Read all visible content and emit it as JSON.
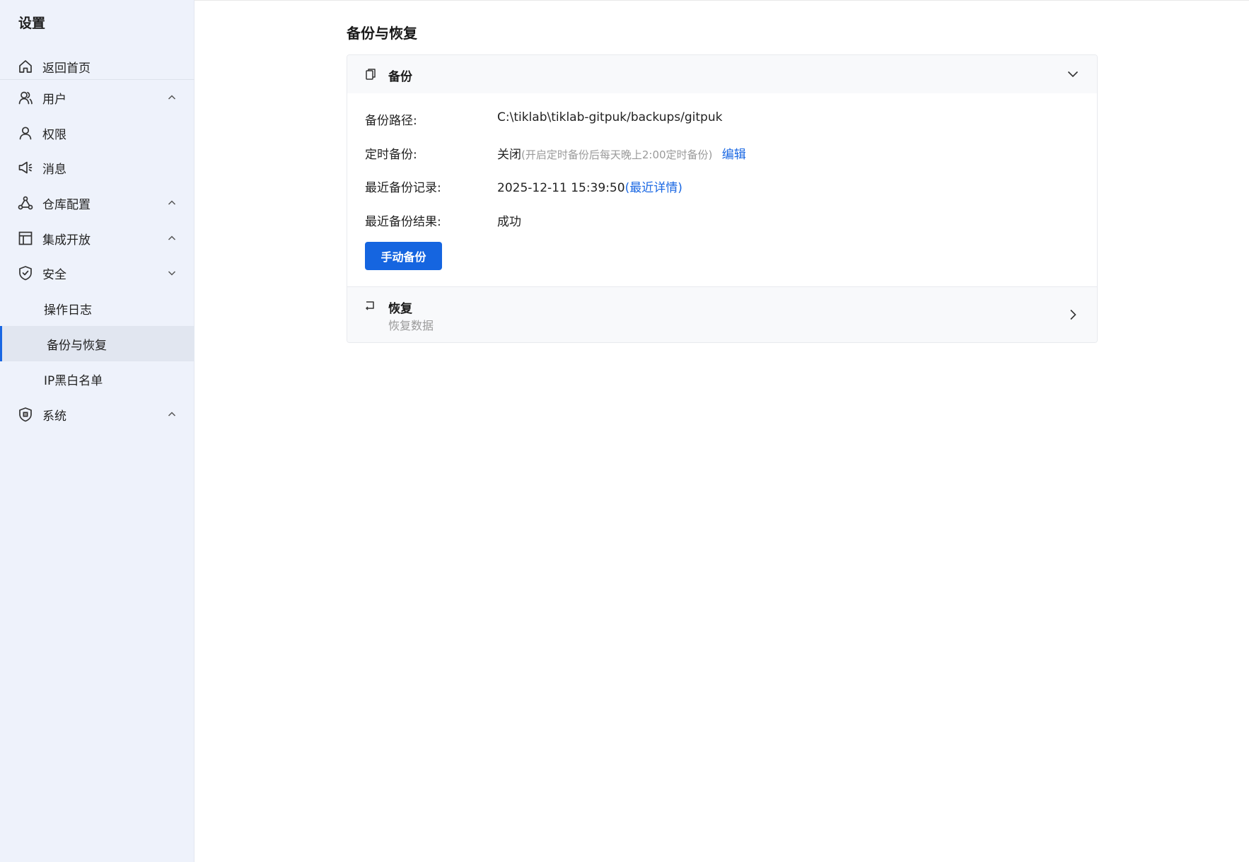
{
  "sidebar": {
    "title": "设置",
    "items": [
      {
        "label": "返回首页",
        "icon": "home-icon"
      },
      {
        "label": "用户",
        "icon": "user-group-icon"
      },
      {
        "label": "权限",
        "icon": "user-icon"
      },
      {
        "label": "消息",
        "icon": "megaphone-icon"
      },
      {
        "label": "仓库配置",
        "icon": "network-icon"
      },
      {
        "label": "集成开放",
        "icon": "layout-icon"
      },
      {
        "label": "安全",
        "icon": "shield-check-icon"
      },
      {
        "label": "操作日志"
      },
      {
        "label": "备份与恢复",
        "active": true
      },
      {
        "label": "IP黑白名单"
      },
      {
        "label": "系统",
        "icon": "certificate-icon"
      }
    ]
  },
  "main": {
    "title": "备份与恢复",
    "backup": {
      "title": "备份",
      "path_label": "备份路径:",
      "path_value": "C:\\tiklab\\tiklab-gitpuk/backups/gitpuk",
      "schedule_label": "定时备份:",
      "schedule_status": "关闭",
      "schedule_hint": "(开启定时备份后每天晚上2:00定时备份)",
      "schedule_edit": "编辑",
      "record_label": "最近备份记录:",
      "record_time": "2025-12-11 15:39:50",
      "record_detail": "(最近详情)",
      "result_label": "最近备份结果:",
      "result_value": "成功",
      "manual_button": "手动备份"
    },
    "restore": {
      "title": "恢复",
      "desc": "恢复数据"
    }
  },
  "colors": {
    "accent": "#1967e3",
    "sidebar_bg": "#eef2fb",
    "button_bg": "#1565e0"
  }
}
